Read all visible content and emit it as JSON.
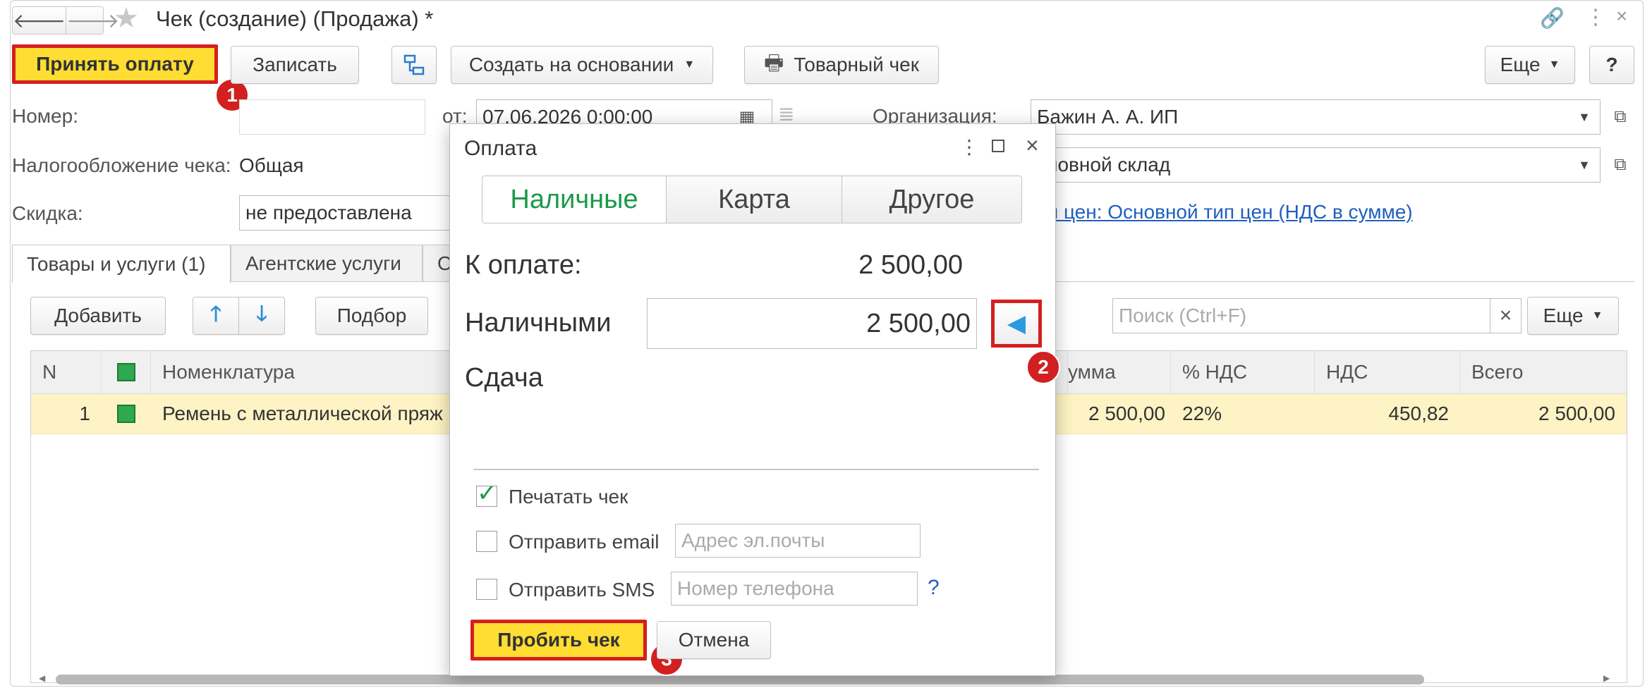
{
  "window": {
    "title": "Чек (создание) (Продажа) *"
  },
  "toolbar": {
    "accept_payment": "Принять оплату",
    "save": "Записать",
    "create_based_on": "Создать на основании",
    "sales_receipt": "Товарный чек",
    "more": "Еще",
    "help": "?"
  },
  "markers": {
    "m1": "1",
    "m2": "2",
    "m3": "3"
  },
  "form": {
    "number_label": "Номер:",
    "number_value": "",
    "date_label": "от:",
    "date_value": "07.06.2026  0:00:00",
    "org_label": "Организация:",
    "org_value": "Бажин А. А. ИП",
    "tax_label": "Налогообложение чека:",
    "tax_value": "Общая",
    "warehouse_value": "сновной склад",
    "discount_label": "Скидка:",
    "discount_value": "не предоставлена",
    "price_type_link": "п цен: Основной тип цен (НДС в сумме)"
  },
  "tabs": [
    {
      "label": "Товары и услуги (1)"
    },
    {
      "label": "Агентские услуги"
    },
    {
      "label": "О"
    }
  ],
  "table_toolbar": {
    "add": "Добавить",
    "pick": "Подбор",
    "search_placeholder": "Поиск (Ctrl+F)",
    "clear": "×",
    "more": "Еще"
  },
  "table": {
    "headers": {
      "n": "N",
      "nomenclature": "Номенклатура",
      "sum": "умма",
      "vat_rate": "% НДС",
      "vat": "НДС",
      "total": "Всего"
    },
    "rows": [
      {
        "n": "1",
        "nomenclature": "Ремень с металлической пряж",
        "sum": "2 500,00",
        "vat_rate": "22%",
        "vat": "450,82",
        "total": "2 500,00"
      }
    ]
  },
  "dialog": {
    "title": "Оплата",
    "tabs": [
      {
        "label": "Наличные"
      },
      {
        "label": "Карта"
      },
      {
        "label": "Другое"
      }
    ],
    "to_pay_label": "К оплате:",
    "to_pay_value": "2 500,00",
    "cash_label": "Наличными",
    "cash_value": "2 500,00",
    "change_label": "Сдача",
    "print_receipt": "Печатать чек",
    "send_email": "Отправить email",
    "email_placeholder": "Адрес эл.почты",
    "send_sms": "Отправить SMS",
    "phone_placeholder": "Номер телефона",
    "help": "?",
    "punch_receipt": "Пробить чек",
    "cancel": "Отмена"
  },
  "colors": {
    "accent_yellow": "#ffdd33",
    "highlight_red": "#d41f1f",
    "link_blue": "#1f5fbf",
    "active_tab_green": "#1a9a4a",
    "row_highlight": "#fdf3c4"
  }
}
